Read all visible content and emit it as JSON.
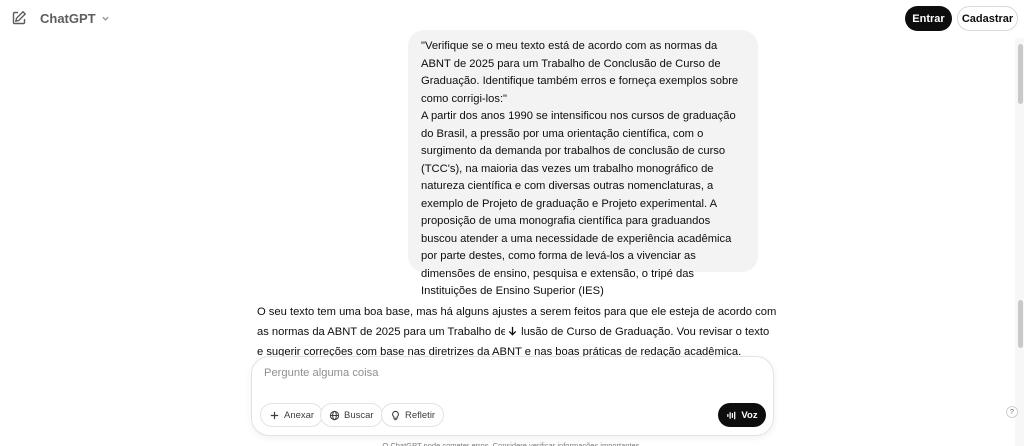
{
  "header": {
    "brand": "ChatGPT",
    "login_label": "Entrar",
    "signup_label": "Cadastrar"
  },
  "conversation": {
    "user_message": {
      "quote": "\"Verifique se o meu texto está de acordo com as normas da ABNT de 2025 para um Trabalho de Conclusão de Curso de Graduação. Identifique também erros e forneça exemplos sobre como corrigi-los:\"",
      "body": "A partir dos anos 1990 se intensificou nos cursos de graduação do Brasil, a pressão por uma orientação científica, com o surgimento da demanda por trabalhos de conclusão de curso (TCC's), na maioria das vezes um trabalho monográfico de natureza científica e com diversas outras nomenclaturas, a exemplo de Projeto de graduação e Projeto experimental. A proposição de uma monografia científica para graduandos buscou atender a uma necessidade de experiência acadêmica por parte destes, como forma de levá-los a vivenciar as dimensões de ensino, pesquisa e extensão, o tripé das Instituições de Ensino Superior (IES)"
    },
    "assistant_message": "O seu texto tem uma boa base, mas há alguns ajustes a serem feitos para que ele esteja de acordo com as normas da ABNT de 2025 para um Trabalho de C     lusão de Curso de Graduação. Vou revisar o texto e sugerir correções com base nas diretrizes da ABNT e nas boas práticas de redação acadêmica."
  },
  "composer": {
    "placeholder": "Pergunte alguma coisa",
    "value": "",
    "attach_label": "Anexar",
    "search_label": "Buscar",
    "think_label": "Refletir",
    "voice_label": "Voz"
  },
  "footer": {
    "note": "O ChatGPT pode cometer erros. Considere verificar informações importantes.",
    "help_label": "?"
  },
  "icons": {
    "new_chat": "edit-icon",
    "brand_menu": "chevron-down-icon",
    "attach": "plus-icon",
    "search": "globe-icon",
    "think": "lightbulb-icon",
    "voice": "waveform-icon",
    "scroll": "arrow-down-icon"
  },
  "colors": {
    "primary_button": "#0d0d0d",
    "user_bubble": "#f3f3f3",
    "muted_text": "#5d5d5d"
  }
}
